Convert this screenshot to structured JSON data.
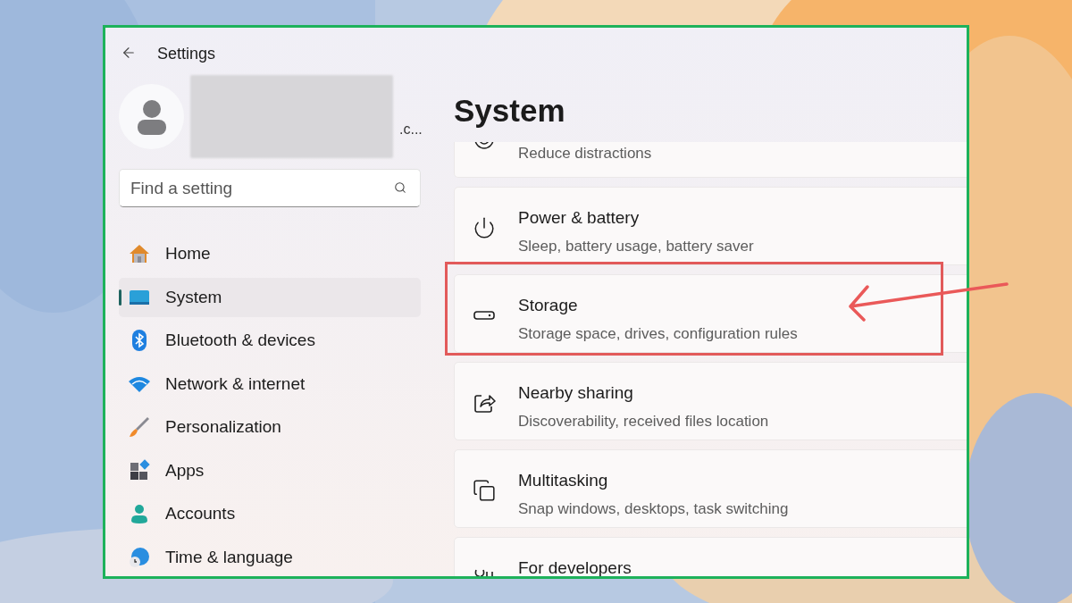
{
  "window": {
    "title": "Settings"
  },
  "account": {
    "visible_text": ".c...",
    "redacted": true
  },
  "search": {
    "placeholder": "Find a setting"
  },
  "sidebar": {
    "items": [
      {
        "label": "Home",
        "selected": false
      },
      {
        "label": "System",
        "selected": true
      },
      {
        "label": "Bluetooth & devices",
        "selected": false
      },
      {
        "label": "Network & internet",
        "selected": false
      },
      {
        "label": "Personalization",
        "selected": false
      },
      {
        "label": "Apps",
        "selected": false
      },
      {
        "label": "Accounts",
        "selected": false
      },
      {
        "label": "Time & language",
        "selected": false
      }
    ]
  },
  "page": {
    "title": "System",
    "cards": [
      {
        "kind": "focus",
        "description": "Reduce distractions",
        "highlighted": false
      },
      {
        "kind": "power",
        "title": "Power & battery",
        "description": "Sleep, battery usage, battery saver",
        "highlighted": false
      },
      {
        "kind": "storage",
        "title": "Storage",
        "description": "Storage space, drives, configuration rules",
        "highlighted": true
      },
      {
        "kind": "sharing",
        "title": "Nearby sharing",
        "description": "Discoverability, received files location",
        "highlighted": false
      },
      {
        "kind": "multitasking",
        "title": "Multitasking",
        "description": "Snap windows, desktops, task switching",
        "highlighted": false
      },
      {
        "kind": "developers",
        "title": "For developers",
        "highlighted": false
      }
    ]
  }
}
